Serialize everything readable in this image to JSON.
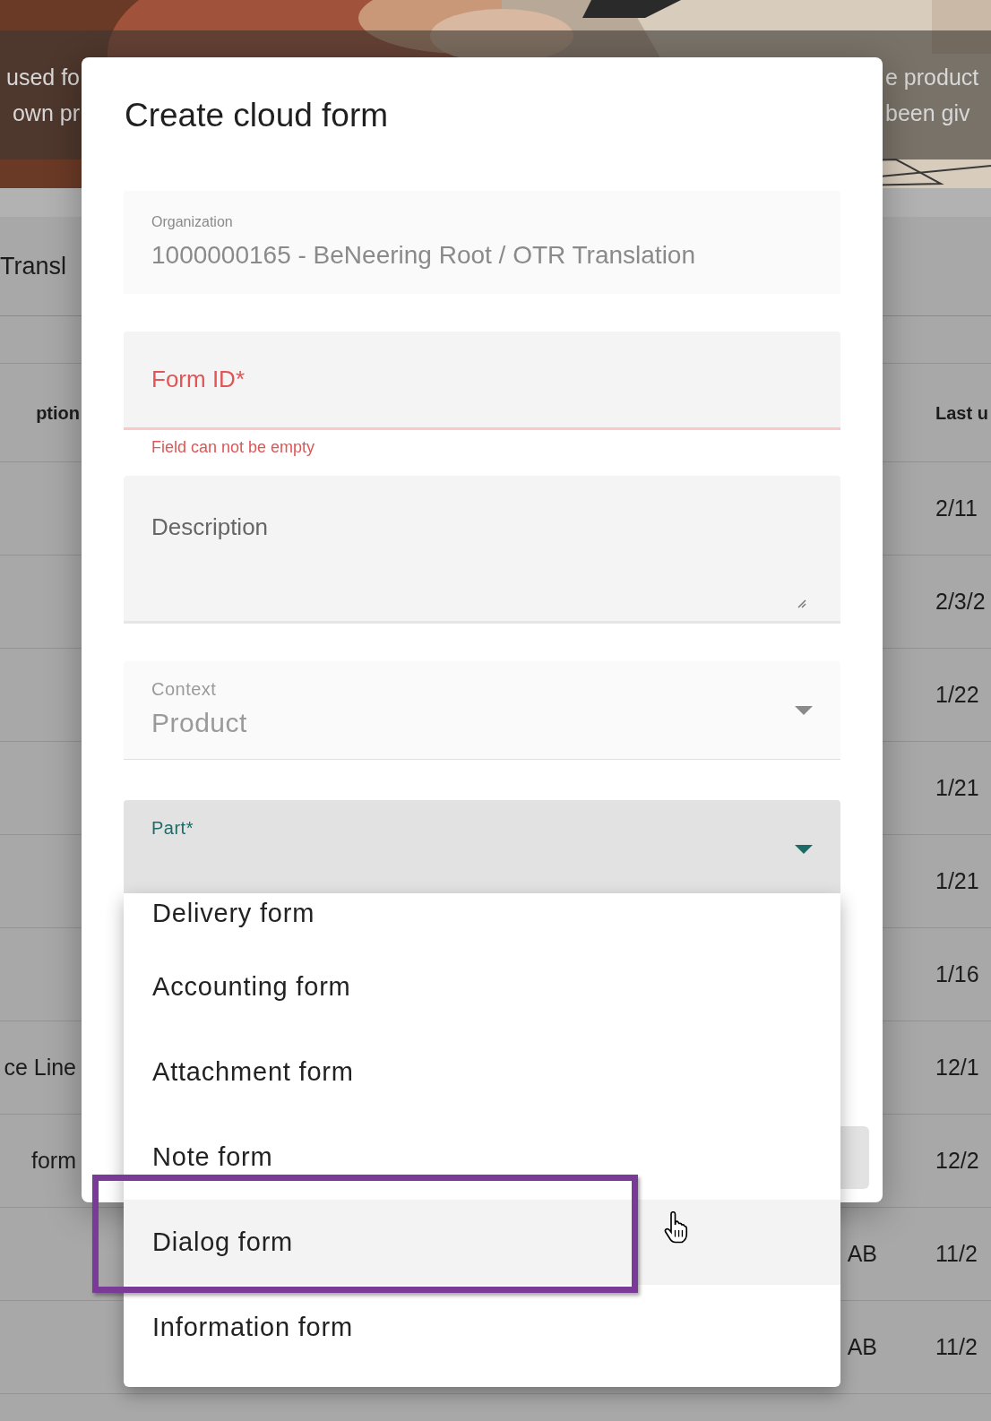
{
  "background": {
    "banner_lines": [
      {
        "left": "used fo",
        "right": "e product"
      },
      {
        "left": "own pr",
        "right": "been giv"
      }
    ],
    "tab": "Transl",
    "table": {
      "columns": [
        "ption",
        "Last u"
      ],
      "rows": [
        {
          "column_3": "2/11"
        },
        {
          "column_3": "2/3/2"
        },
        {
          "column_3": "1/22"
        },
        {
          "column_3": "1/21"
        },
        {
          "column_3": "1/21"
        },
        {
          "column_3": "1/16"
        },
        {
          "column_1": "ce Line",
          "column_3": "12/1"
        },
        {
          "column_1": "form",
          "column_3": "12/2"
        },
        {
          "column_2": "AB",
          "column_3": "11/2"
        },
        {
          "column_2": "AB",
          "column_3": "11/2"
        }
      ]
    }
  },
  "dialog": {
    "title": "Create cloud form",
    "fields": [
      {
        "kind": "text",
        "label": "Organization",
        "value": "1000000165 - BeNeering Root / OTR Translation",
        "disabled": true
      },
      {
        "kind": "text",
        "label": "Form ID*",
        "error": "Field can not be empty",
        "disabled": false
      },
      {
        "kind": "textarea",
        "label": "Description",
        "disabled": false
      },
      {
        "kind": "select",
        "label": "Context",
        "value": "Product",
        "disabled": true,
        "focused": false
      },
      {
        "kind": "select",
        "label": "Part*",
        "disabled": false,
        "focused": true
      }
    ],
    "menu": {
      "items": [
        {
          "label": "Delivery form",
          "selected": false
        },
        {
          "label": "Accounting form",
          "selected": false
        },
        {
          "label": "Attachment form",
          "selected": false
        },
        {
          "label": "Note form",
          "selected": false
        },
        {
          "label": "Dialog form",
          "selected": true
        },
        {
          "label": "Information form",
          "selected": false
        }
      ]
    }
  }
}
